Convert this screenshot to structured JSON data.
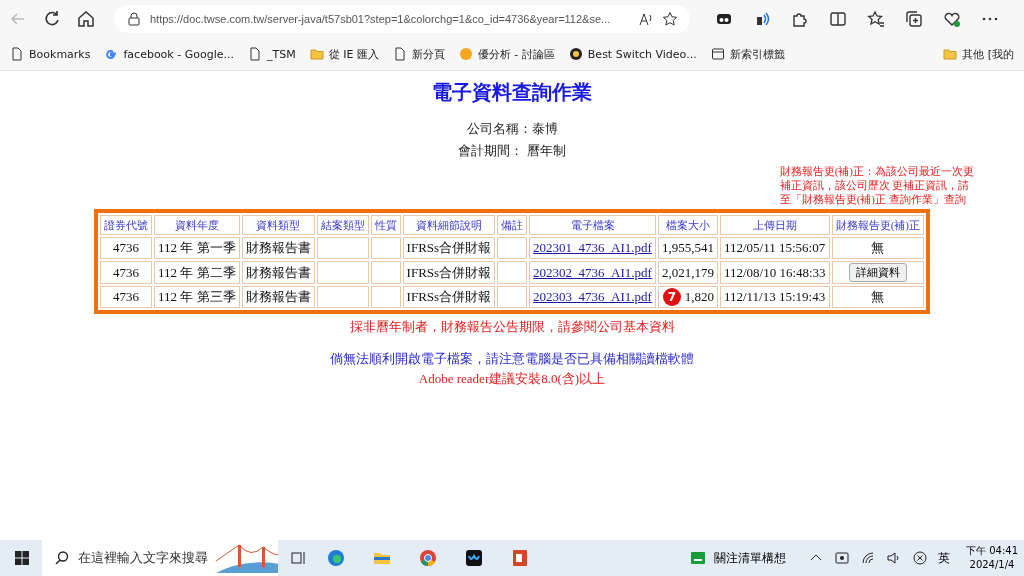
{
  "browser": {
    "url": "https://doc.twse.com.tw/server-java/t57sb01?step=1&colorchg=1&co_id=4736&year=112&se...",
    "bookmarks": [
      {
        "label": "Bookmarks",
        "kind": "page"
      },
      {
        "label": "facebook - Google...",
        "kind": "google"
      },
      {
        "label": "_TSM",
        "kind": "page"
      },
      {
        "label": "從 IE 匯入",
        "kind": "folder"
      },
      {
        "label": "新分頁",
        "kind": "page"
      },
      {
        "label": "優分析 - 討論區",
        "kind": "orange"
      },
      {
        "label": "Best Switch Video...",
        "kind": "dark"
      },
      {
        "label": "新索引標籤",
        "kind": "tab"
      }
    ],
    "other_bookmarks": "其他 [我的"
  },
  "page": {
    "title": "電子資料查詢作業",
    "company": "公司名稱：泰博",
    "period": "會計期間： 曆年制",
    "note": [
      "財務報告更(補)正：為該公司最近一次更",
      "補正資訊，該公司歷次 更補正資訊，請",
      "至「財務報告更(補)正 查詢作業」查詢"
    ],
    "table": {
      "columns": [
        "證券代號",
        "資料年度",
        "資料類型",
        "結案類型",
        "性質",
        "資料細節說明",
        "備註",
        "電子檔案",
        "檔案大小",
        "上傳日期",
        "財務報告更(補)正"
      ],
      "rows": [
        {
          "code": "4736",
          "year": "112 年 第一季",
          "type": "財務報告書",
          "detail": "IFRSs合併財報",
          "file": "202301_4736_AI1.pdf",
          "size": "1,955,541",
          "date": "112/05/11 15:56:07",
          "correction": {
            "kind": "text",
            "label": "無"
          }
        },
        {
          "code": "4736",
          "year": "112 年 第二季",
          "type": "財務報告書",
          "detail": "IFRSs合併財報",
          "file": "202302_4736_AI1.pdf",
          "size": "2,021,179",
          "date": "112/08/10 16:48:33",
          "correction": {
            "kind": "button",
            "label": "詳細資料"
          }
        },
        {
          "code": "4736",
          "year": "112 年 第三季",
          "type": "財務報告書",
          "detail": "IFRSs合併財報",
          "file": "202303_4736_AI1.pdf",
          "size": "1,820",
          "marker": "7",
          "date": "112/11/13 15:19:43",
          "correction": {
            "kind": "text",
            "label": "無"
          }
        }
      ]
    },
    "notice": "採非曆年制者，財務報告公告期限，請參閱公司基本資料",
    "warning": "倘無法順利開啟電子檔案，請注意電腦是否已具備相關讀檔軟體",
    "adobe": "Adobe reader建議安裝8.0(含)以上"
  },
  "taskbar": {
    "search_placeholder": "在這裡輸入文字來搜尋",
    "widget": "關注清單構想",
    "ime": "英",
    "time": "下午 04:41",
    "date": "2024/1/4"
  }
}
